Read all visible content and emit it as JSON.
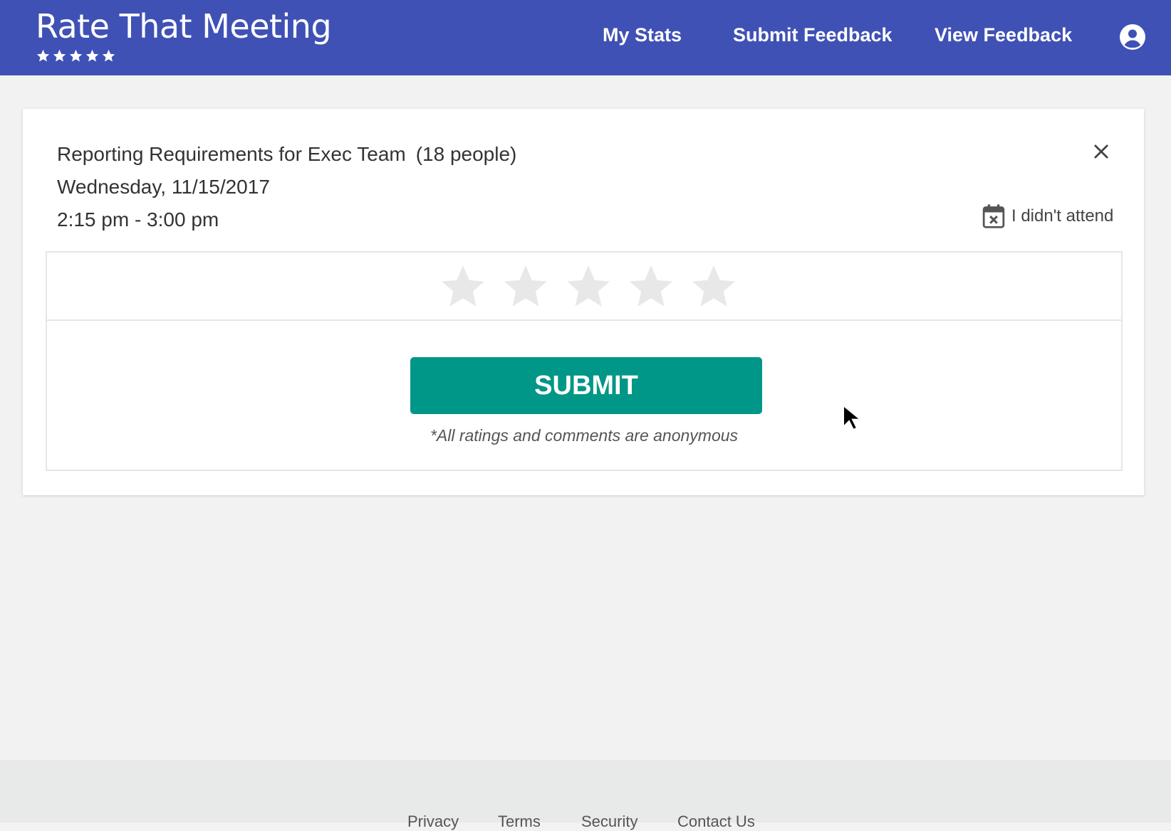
{
  "header": {
    "app_title": "Rate That Meeting",
    "nav": {
      "my_stats": "My Stats",
      "submit_feedback": "Submit Feedback",
      "view_feedback": "View Feedback"
    },
    "icons": [
      "star-icon",
      "account-circle-icon"
    ],
    "background_color": "#3f51b5"
  },
  "meeting": {
    "title": "Reporting Requirements for Exec Team",
    "attendees": "(18 people)",
    "date": "Wednesday, 11/15/2017",
    "time": "2:15 pm - 3:00 pm",
    "didnt_attend_label": "I didn't attend"
  },
  "rating": {
    "max_stars": 5,
    "current_rating": 0,
    "empty_star_color": "#e8e8e8"
  },
  "form": {
    "submit_label": "SUBMIT",
    "submit_color": "#009688",
    "anonymous_note": "*All ratings and comments are anonymous"
  },
  "footer": {
    "links": [
      "Privacy",
      "Terms",
      "Security",
      "Contact Us"
    ]
  }
}
